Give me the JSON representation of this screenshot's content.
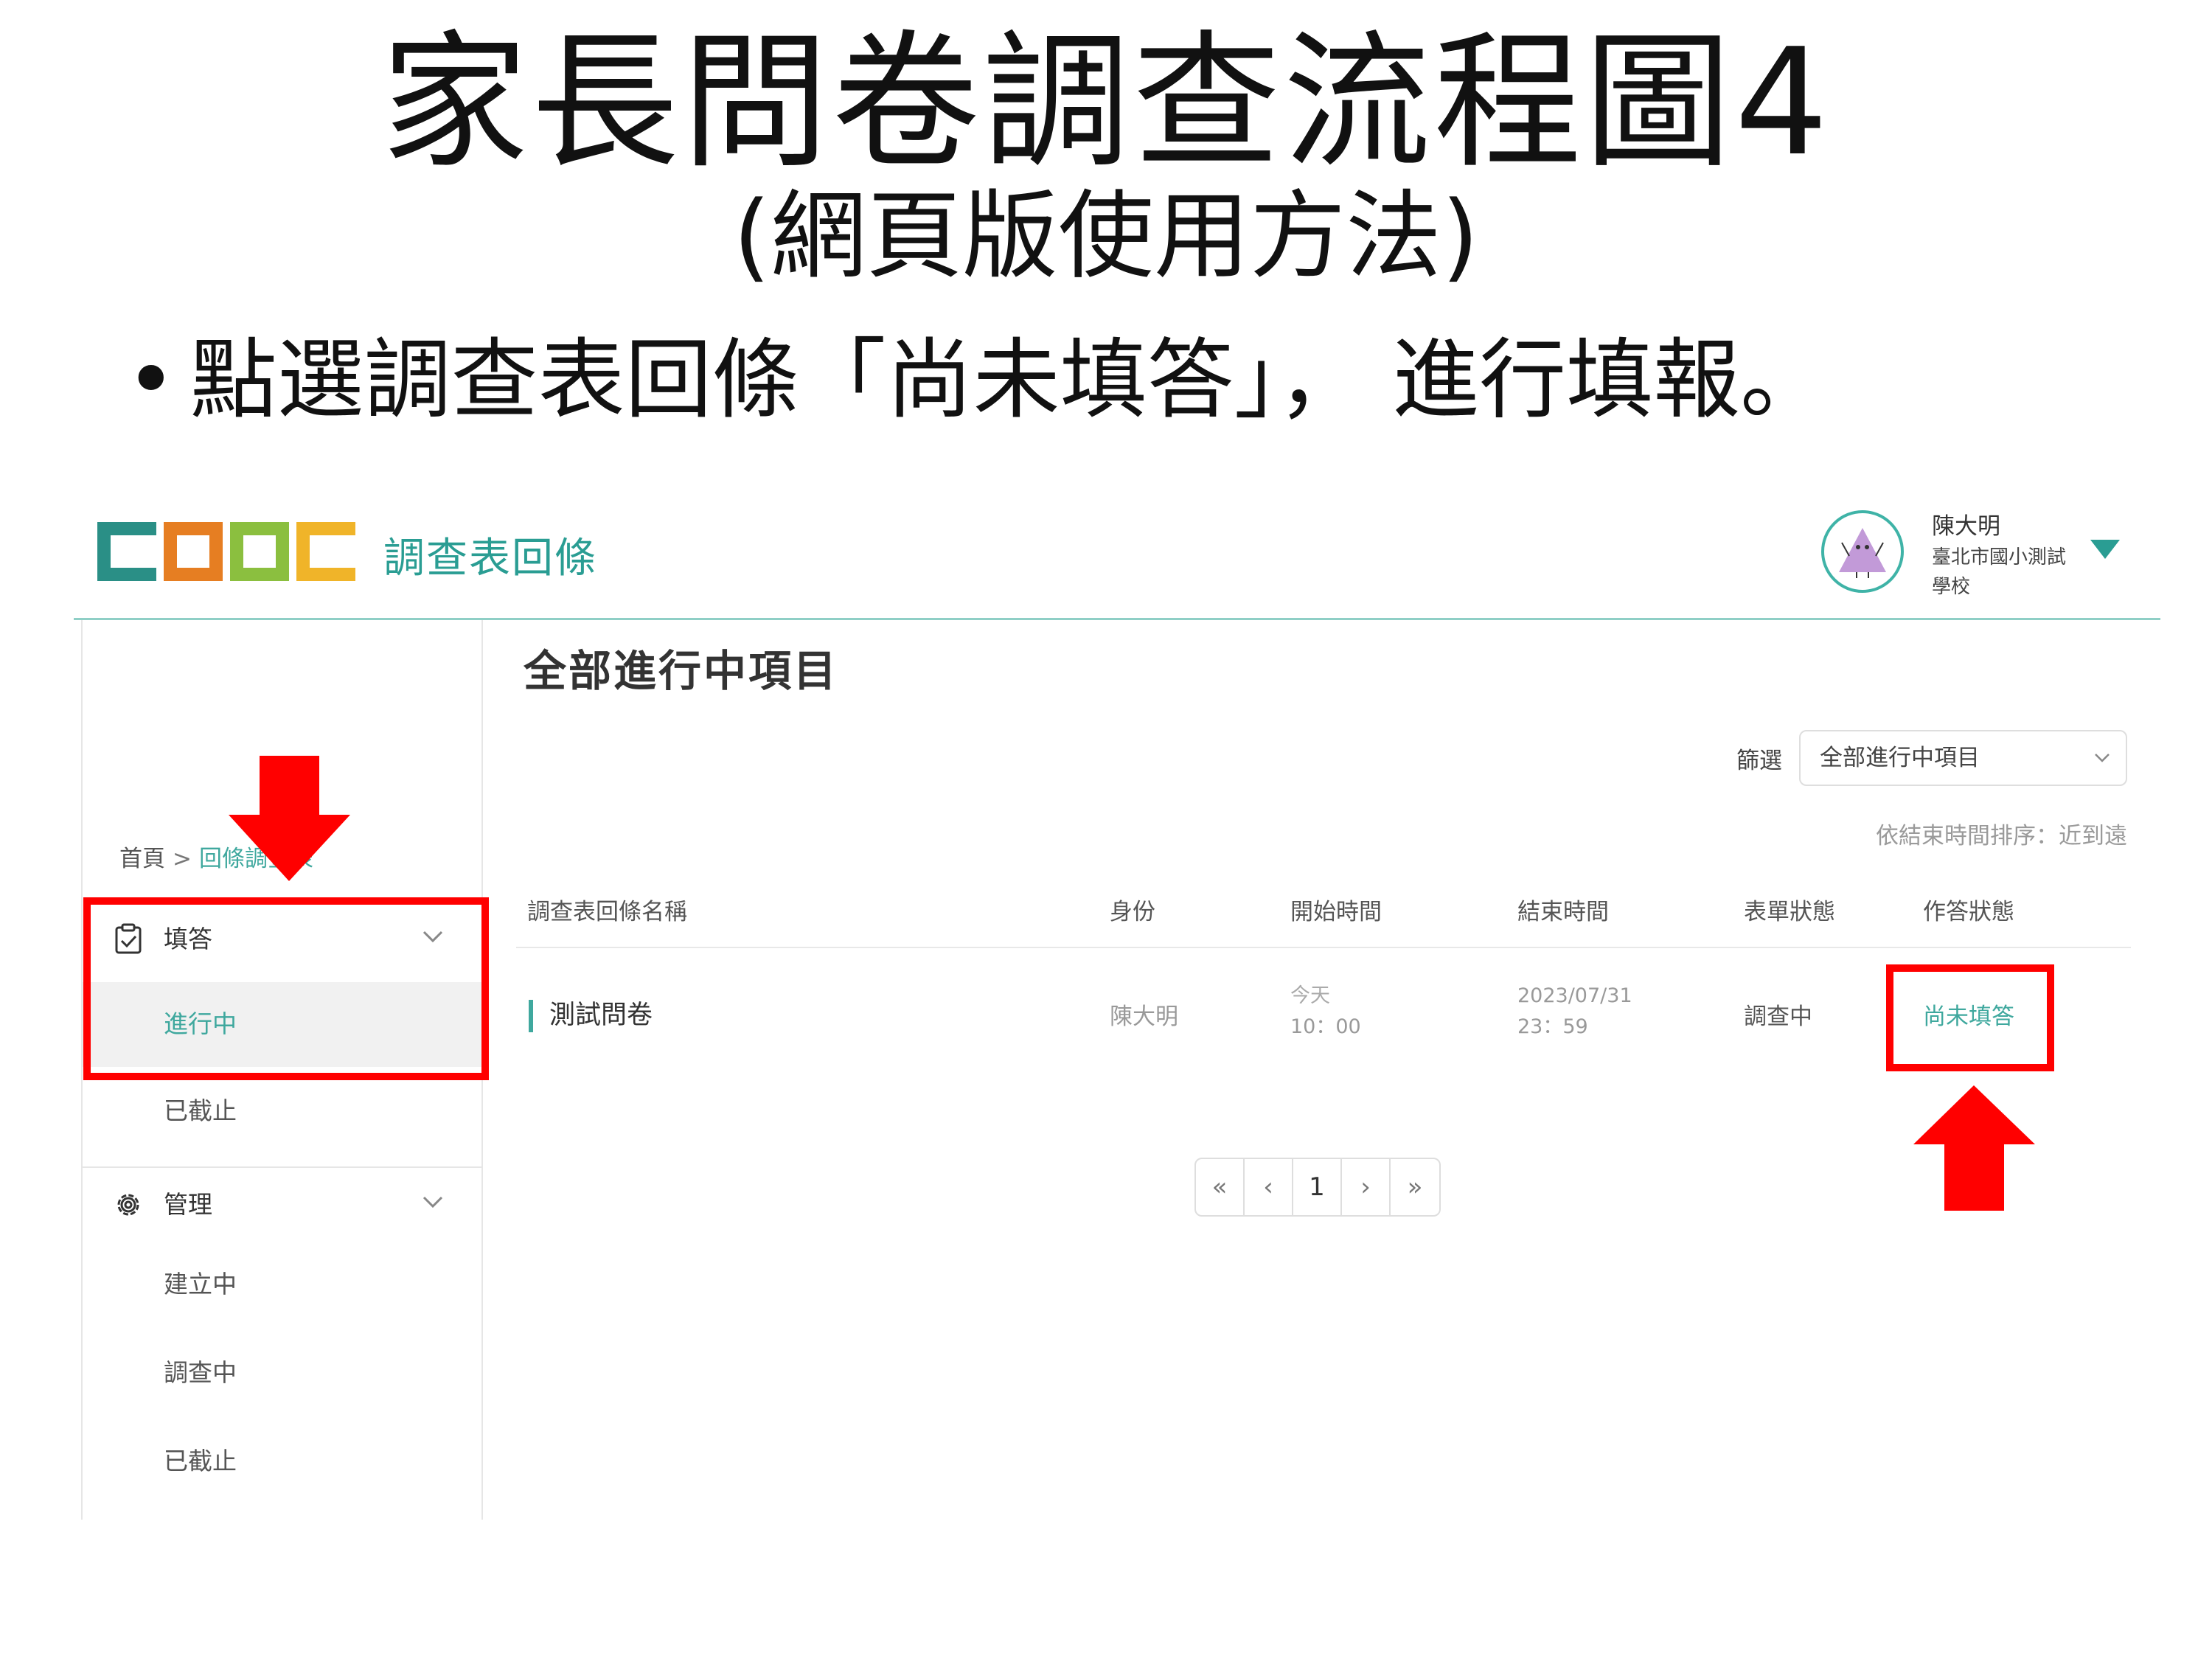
{
  "slide": {
    "title": "家長問卷調查流程圖4",
    "subtitle": "(網頁版使用方法)",
    "bullet": "點選調查表回條「尚未填答」， 進行填報。"
  },
  "header": {
    "app_title": "調查表回條",
    "user_name": "陳大明",
    "user_school": "臺北市國小測試學校"
  },
  "breadcrumb": {
    "home": "首頁",
    "separator": ">",
    "current": "回條調查表"
  },
  "sidebar": {
    "group_fill": {
      "label": "填答",
      "icon": "clipboard-check-icon"
    },
    "fill_items": [
      "進行中",
      "已截止"
    ],
    "group_manage": {
      "label": "管理",
      "icon": "gear-icon"
    },
    "manage_items": [
      "建立中",
      "調查中",
      "已截止"
    ]
  },
  "main": {
    "heading": "全部進行中項目",
    "filter_label": "篩選",
    "filter_value": "全部進行中項目",
    "sort_text": "依結束時間排序：近到遠",
    "columns": [
      "調查表回條名稱",
      "身份",
      "開始時間",
      "結束時間",
      "表單狀態",
      "作答狀態"
    ],
    "rows": [
      {
        "name": "測試問卷",
        "identity": "陳大明",
        "start_day": "今天",
        "start_time": "10：00",
        "end_date": "2023/07/31",
        "end_time": "23：59",
        "form_status": "調查中",
        "answer_status": "尚未填答"
      }
    ],
    "pagination": [
      "«",
      "‹",
      "1",
      "›",
      "»"
    ]
  },
  "colors": {
    "accent": "#3fa89e",
    "highlight": "#ff0000",
    "logo": [
      "#2a8f86",
      "#e67e22",
      "#8bbf3f",
      "#f0b429"
    ]
  }
}
